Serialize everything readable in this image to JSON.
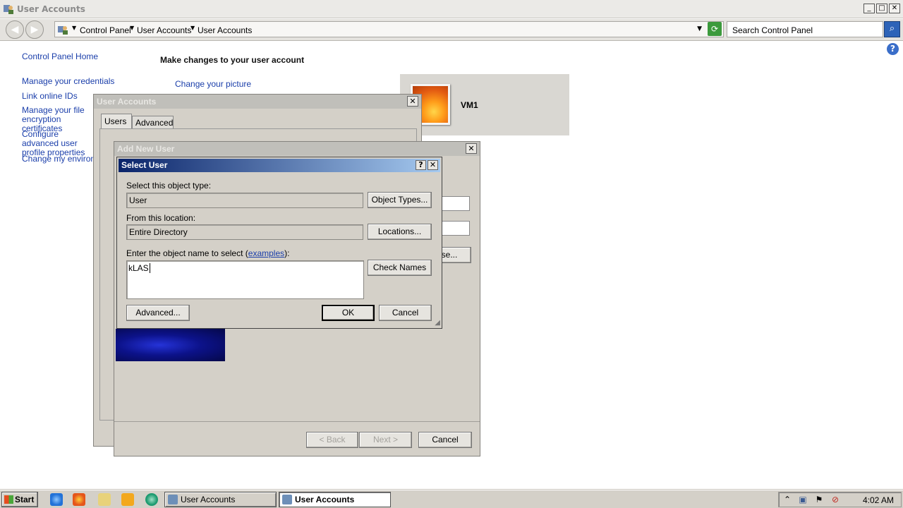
{
  "window": {
    "title": "User Accounts"
  },
  "address": {
    "crumbs": [
      "Control Panel",
      "User Accounts",
      "User Accounts"
    ],
    "search_placeholder": "Search Control Panel"
  },
  "sidebar": {
    "home": "Control Panel Home",
    "items": [
      "Manage your credentials",
      "Link online IDs",
      "Manage your file encryption certificates",
      "Configure advanced user profile properties",
      "Change my environment variables"
    ]
  },
  "main": {
    "heading": "Make changes to your user account",
    "change_picture": "Change your picture",
    "username": "VM1"
  },
  "dialog_user_accounts": {
    "title": "User Accounts",
    "tabs": [
      "Users",
      "Advanced"
    ]
  },
  "dialog_add_user": {
    "title": "Add New User",
    "browse_fragment": "se...",
    "back": "< Back",
    "next": "Next >",
    "cancel": "Cancel"
  },
  "dialog_select_user": {
    "title": "Select User",
    "object_type_label": "Select this object type:",
    "object_type_value": "User",
    "object_types_button": "Object Types...",
    "location_label": "From this location:",
    "location_value": "Entire Directory",
    "locations_button": "Locations...",
    "name_label": "Enter the object name to select (",
    "examples_link": "examples",
    "name_label_end": "):",
    "name_value": "kLAS",
    "check_names_button": "Check Names",
    "advanced_button": "Advanced...",
    "ok_button": "OK",
    "cancel_button": "Cancel"
  },
  "taskbar": {
    "start": "Start",
    "tasks": [
      "User Accounts",
      "User Accounts"
    ],
    "clock": "4:02 AM"
  }
}
